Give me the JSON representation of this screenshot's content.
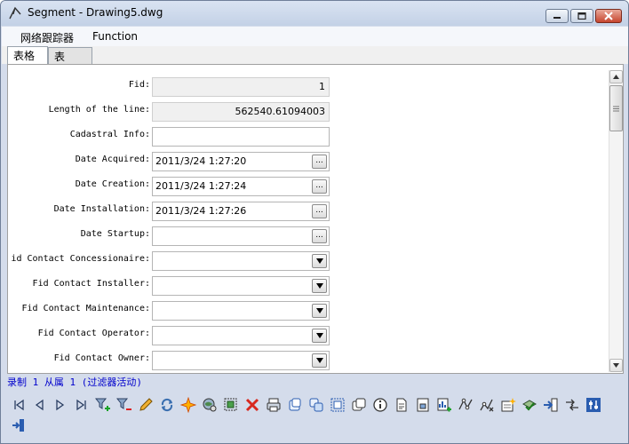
{
  "window": {
    "title": "Segment - Drawing5.dwg",
    "icons": {
      "app": "segment-app-icon",
      "minimize": "minimize-icon",
      "maximize": "maximize-icon",
      "close": "close-icon"
    }
  },
  "menu": {
    "items": [
      {
        "label": "网络跟踪器"
      },
      {
        "label": "Function"
      }
    ]
  },
  "tabs": [
    {
      "label": "表格",
      "active": true
    },
    {
      "label": "表",
      "active": false
    }
  ],
  "form": {
    "fields": [
      {
        "label": "Fid:",
        "value": "1",
        "kind": "readonly"
      },
      {
        "label": "Length of the line:",
        "value": "562540.61094003",
        "kind": "readonly"
      },
      {
        "label": "Cadastral Info:",
        "value": "",
        "kind": "text"
      },
      {
        "label": "Date Acquired:",
        "value": "2011/3/24 1:27:20",
        "kind": "date"
      },
      {
        "label": "Date Creation:",
        "value": "2011/3/24 1:27:24",
        "kind": "date"
      },
      {
        "label": "Date Installation:",
        "value": "2011/3/24 1:27:26",
        "kind": "date"
      },
      {
        "label": "Date Startup:",
        "value": "",
        "kind": "date"
      },
      {
        "label": "id Contact Concessionaire:",
        "value": "",
        "kind": "select"
      },
      {
        "label": "Fid Contact Installer:",
        "value": "",
        "kind": "select"
      },
      {
        "label": "Fid Contact Maintenance:",
        "value": "",
        "kind": "select"
      },
      {
        "label": "Fid Contact Operator:",
        "value": "",
        "kind": "select"
      },
      {
        "label": "Fid Contact Owner:",
        "value": "",
        "kind": "select"
      }
    ],
    "ellipsis_label": "..."
  },
  "status": {
    "text": "录制 1 从属 1 (过滤器活动)",
    "color": "#0000cc"
  },
  "toolbar": {
    "tools": [
      "first-record-icon",
      "previous-record-icon",
      "next-record-icon",
      "last-record-icon",
      "add-filter-icon",
      "remove-filter-icon",
      "edit-pencil-icon",
      "refresh-icon",
      "highlight-icon",
      "zoom-globe-icon",
      "select-object-icon",
      "delete-icon",
      "print-icon",
      "copy-icon",
      "duplicate-icon",
      "select-frame-icon",
      "stack-icon",
      "info-icon",
      "document-icon",
      "report-icon",
      "chart-add-icon",
      "route-icon",
      "network-trace-icon",
      "new-sheet-icon",
      "check-layer-icon",
      "export-icon",
      "link-icon",
      "settings-icon",
      "exit-icon"
    ]
  }
}
